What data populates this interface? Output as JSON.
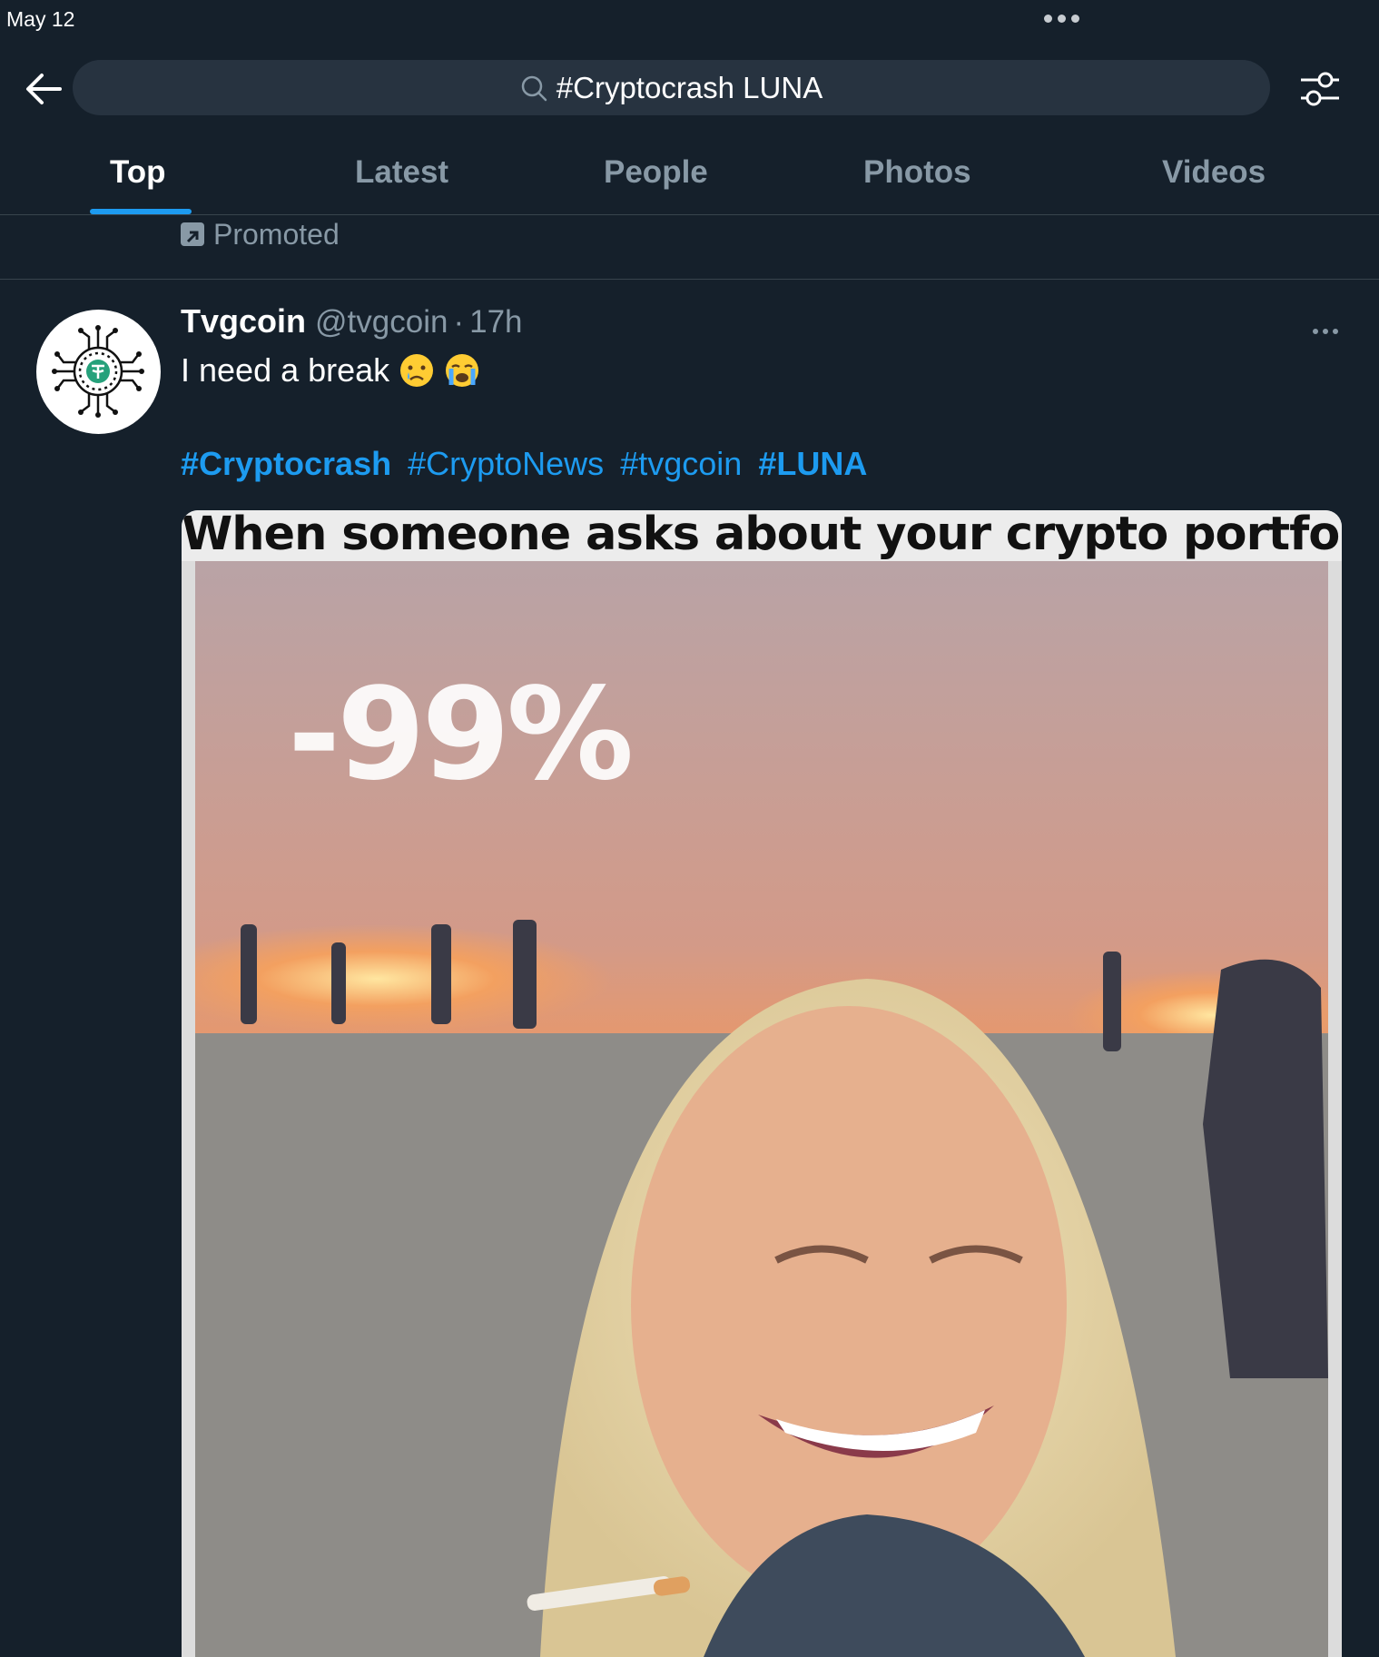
{
  "status_bar": {
    "date": "May 12"
  },
  "search": {
    "query": "#Cryptocrash LUNA"
  },
  "tabs": [
    {
      "label": "Top",
      "active": true
    },
    {
      "label": "Latest",
      "active": false
    },
    {
      "label": "People",
      "active": false
    },
    {
      "label": "Photos",
      "active": false
    },
    {
      "label": "Videos",
      "active": false
    }
  ],
  "promoted": {
    "label": "Promoted"
  },
  "tweet": {
    "author_name": "Tvgcoin",
    "author_handle": "@tvgcoin",
    "separator": "·",
    "time": "17h",
    "text": "I need a break",
    "emojis": [
      "crying-face",
      "loudly-crying-face"
    ],
    "hashtags": [
      {
        "text": "#Cryptocrash",
        "bold": true
      },
      {
        "text": "#CryptoNews",
        "bold": false
      },
      {
        "text": "#tvgcoin",
        "bold": false
      },
      {
        "text": "#LUNA",
        "bold": true
      }
    ],
    "media": {
      "caption": "When someone asks about your crypto portfolio:",
      "overlay": "-99%"
    }
  },
  "colors": {
    "background": "#15202b",
    "search_bg": "#273340",
    "accent": "#1d9bf0",
    "muted_text": "#8899a6",
    "divider": "#38444d"
  }
}
